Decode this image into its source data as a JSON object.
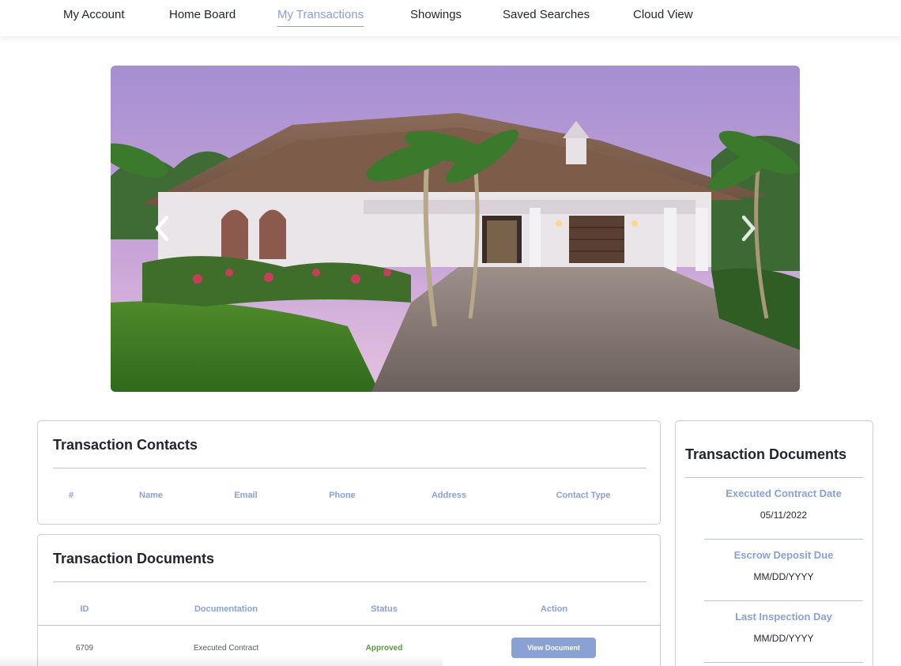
{
  "nav": {
    "items": [
      {
        "label": "My Account",
        "active": false
      },
      {
        "label": "Home Board",
        "active": false
      },
      {
        "label": "My Transactions",
        "active": true
      },
      {
        "label": "Showings",
        "active": false
      },
      {
        "label": "Saved Searches",
        "active": false
      },
      {
        "label": "Cloud View",
        "active": false
      }
    ]
  },
  "hero": {
    "prev_icon": "chevron-left-icon",
    "next_icon": "chevron-right-icon"
  },
  "contacts": {
    "title": "Transaction Contacts",
    "columns": [
      "#",
      "Name",
      "Email",
      "Phone",
      "Address",
      "Contact Type"
    ]
  },
  "documents": {
    "title": "Transaction Documents",
    "columns": [
      "ID",
      "Documentation",
      "Status",
      "Action"
    ],
    "rows": [
      {
        "id": "6709",
        "documentation": "Executed Contract",
        "status": "Approved",
        "action": "View Document"
      }
    ]
  },
  "side": {
    "title": "Transaction Documents",
    "fields": [
      {
        "label": "Executed Contract Date",
        "value": "05/11/2022"
      },
      {
        "label": "Escrow Deposit Due",
        "value": "MM/DD/YYYY"
      },
      {
        "label": "Last Inspection Day",
        "value": "MM/DD/YYYY"
      }
    ]
  },
  "colors": {
    "accent": "#8aa1d6",
    "approved": "#5a9a3b",
    "text": "#1f2430"
  }
}
